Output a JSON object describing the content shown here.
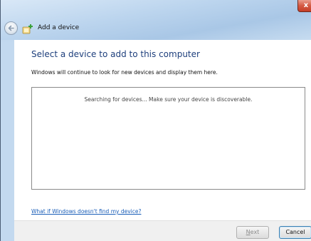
{
  "window": {
    "title": "Add a device",
    "close_label": "x"
  },
  "main": {
    "heading": "Select a device to add to this computer",
    "description": "Windows will continue to look for new devices and display them here.",
    "status_text": "Searching for devices...  Make sure your device is discoverable.",
    "help_link": "What if Windows doesn't find my device?"
  },
  "footer": {
    "next_first": "N",
    "next_rest": "ext",
    "cancel_label": "Cancel"
  },
  "icons": {
    "back": "back-arrow-icon",
    "add_device": "add-device-icon",
    "close": "close-icon"
  }
}
